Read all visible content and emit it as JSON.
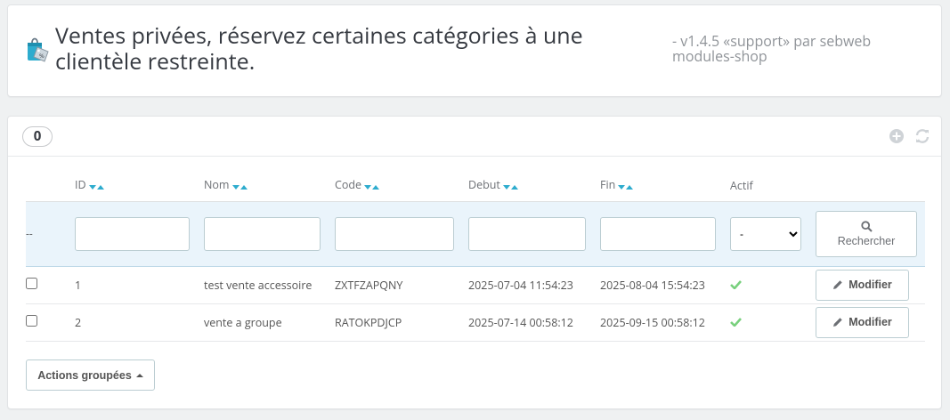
{
  "header": {
    "title": "Ventes privées, réservez certaines catégories à une clientèle restreinte.",
    "version_line1": "- v1.4.5 «support» par sebweb",
    "version_line2": "modules-shop",
    "icon": "shopping-bag-discount-icon"
  },
  "list": {
    "count": "0",
    "tools": [
      "add-icon",
      "refresh-icon"
    ],
    "columns": [
      "ID",
      "Nom",
      "Code",
      "Debut",
      "Fin",
      "Actif"
    ],
    "filters": {
      "dash": "--",
      "actif_selected": "-",
      "search_label": "Rechercher"
    },
    "rows": [
      {
        "id": "1",
        "nom": "test vente accessoire",
        "code": "ZXTFZAPQNY",
        "debut": "2025-07-04 11:54:23",
        "fin": "2025-08-04 15:54:23",
        "actif": true,
        "action": "Modifier"
      },
      {
        "id": "2",
        "nom": "vente a groupe",
        "code": "RATOKPDJCP",
        "debut": "2025-07-14 00:58:12",
        "fin": "2025-09-15 00:58:12",
        "actif": true,
        "action": "Modifier"
      }
    ],
    "bulk_label": "Actions groupées"
  },
  "colors": {
    "accent": "#2eacce",
    "active_check": "#78d07d",
    "filter_bg": "#eaf4fb"
  }
}
